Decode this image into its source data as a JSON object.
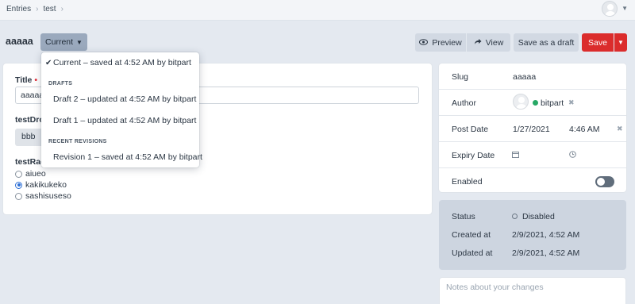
{
  "breadcrumbs": [
    "Entries",
    "test"
  ],
  "entry": {
    "title": "aaaaa",
    "revision_label": "Current"
  },
  "toolbar": {
    "preview_label": "Preview",
    "view_label": "View",
    "draft_label": "Save as a draft",
    "save_label": "Save"
  },
  "revision_menu": {
    "current": "Current – saved at 4:52 AM by bitpart",
    "drafts_heading": "DRAFTS",
    "drafts": [
      "Draft 2 – updated at 4:52 AM by bitpart",
      "Draft 1 – updated at 4:52 AM by bitpart"
    ],
    "revisions_heading": "RECENT REVISIONS",
    "revisions": [
      "Revision 1 – saved at 4:52 AM by bitpart"
    ]
  },
  "fields": {
    "title_label": "Title",
    "title_value": "aaaaa",
    "dropdown_label": "testDro",
    "dropdown_value": "bbb",
    "radio_label": "testRac",
    "radio_options": [
      "aiueo",
      "kakikukeko",
      "sashisuseso"
    ],
    "radio_selected": "kakikukeko"
  },
  "meta": {
    "slug_label": "Slug",
    "slug_value": "aaaaa",
    "author_label": "Author",
    "author_name": "bitpart",
    "post_date_label": "Post Date",
    "post_date": "1/27/2021",
    "post_time": "4:46 AM",
    "expiry_date_label": "Expiry Date",
    "enabled_label": "Enabled"
  },
  "status": {
    "status_label": "Status",
    "status_value": "Disabled",
    "created_label": "Created at",
    "created_value": "2/9/2021, 4:52 AM",
    "updated_label": "Updated at",
    "updated_value": "2/9/2021, 4:52 AM"
  },
  "notes_placeholder": "Notes about your changes",
  "colors": {
    "save": "#db2c2c",
    "author_status": "#27a865",
    "radio_accent": "#2e70d6"
  }
}
